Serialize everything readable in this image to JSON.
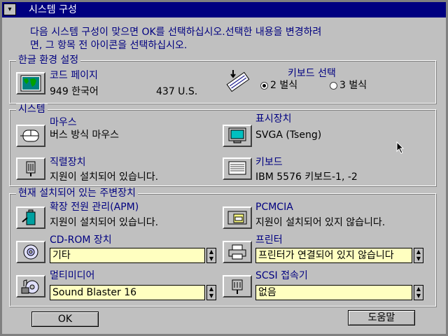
{
  "window": {
    "title": "시스템 구성",
    "sysmenu_glyph": "▾"
  },
  "intro": "다음 시스템 구성이 맞으면 OK를 선택하십시오.선택한 내용을 변경하려\n면, 그 항목 전 아이콘을 선택하십시오.",
  "hangul_env": {
    "group_label": "한글 환경 설정",
    "codepage_label": "코드 페이지",
    "codepage_value": "949 한국어",
    "codepage_alt": "437 U.S.",
    "keyboard_select_label": "키보드 선택",
    "options": [
      {
        "label": "2 벌식",
        "selected": true
      },
      {
        "label": "3 벌식",
        "selected": false
      }
    ]
  },
  "system": {
    "group_label": "시스템",
    "mouse_label": "마우스",
    "mouse_value": "버스 방식 마우스",
    "display_label": "표시장치",
    "display_value": "SVGA (Tseng)",
    "serial_label": "직렬장치",
    "serial_value": "지원이 설치되어 있습니다.",
    "keyboard_label": "키보드",
    "keyboard_value": "IBM 5576 키보드-1, -2"
  },
  "peripherals": {
    "group_label": "현재 설치되어 있는 주변장치",
    "apm_label": "확장 전원 관리(APM)",
    "apm_value": "지원이 설치되어 있습니다.",
    "pcmcia_label": "PCMCIA",
    "pcmcia_value": "지원이 설치되어 있지 않습니다.",
    "cdrom_label": "CD-ROM 장치",
    "cdrom_value": "기타",
    "printer_label": "프린터",
    "printer_value": "프린터가 연결되어 있지 않습니다",
    "multimedia_label": "멀티미디어",
    "multimedia_value": "Sound Blaster 16",
    "scsi_label": "SCSI 접속기",
    "scsi_value": "없음"
  },
  "buttons": {
    "ok": "OK",
    "help": "도움말"
  },
  "colors": {
    "title_bar": "#000080",
    "face": "#c0c0c0",
    "label_blue": "#000080",
    "combo_bg": "#ffffc0"
  }
}
